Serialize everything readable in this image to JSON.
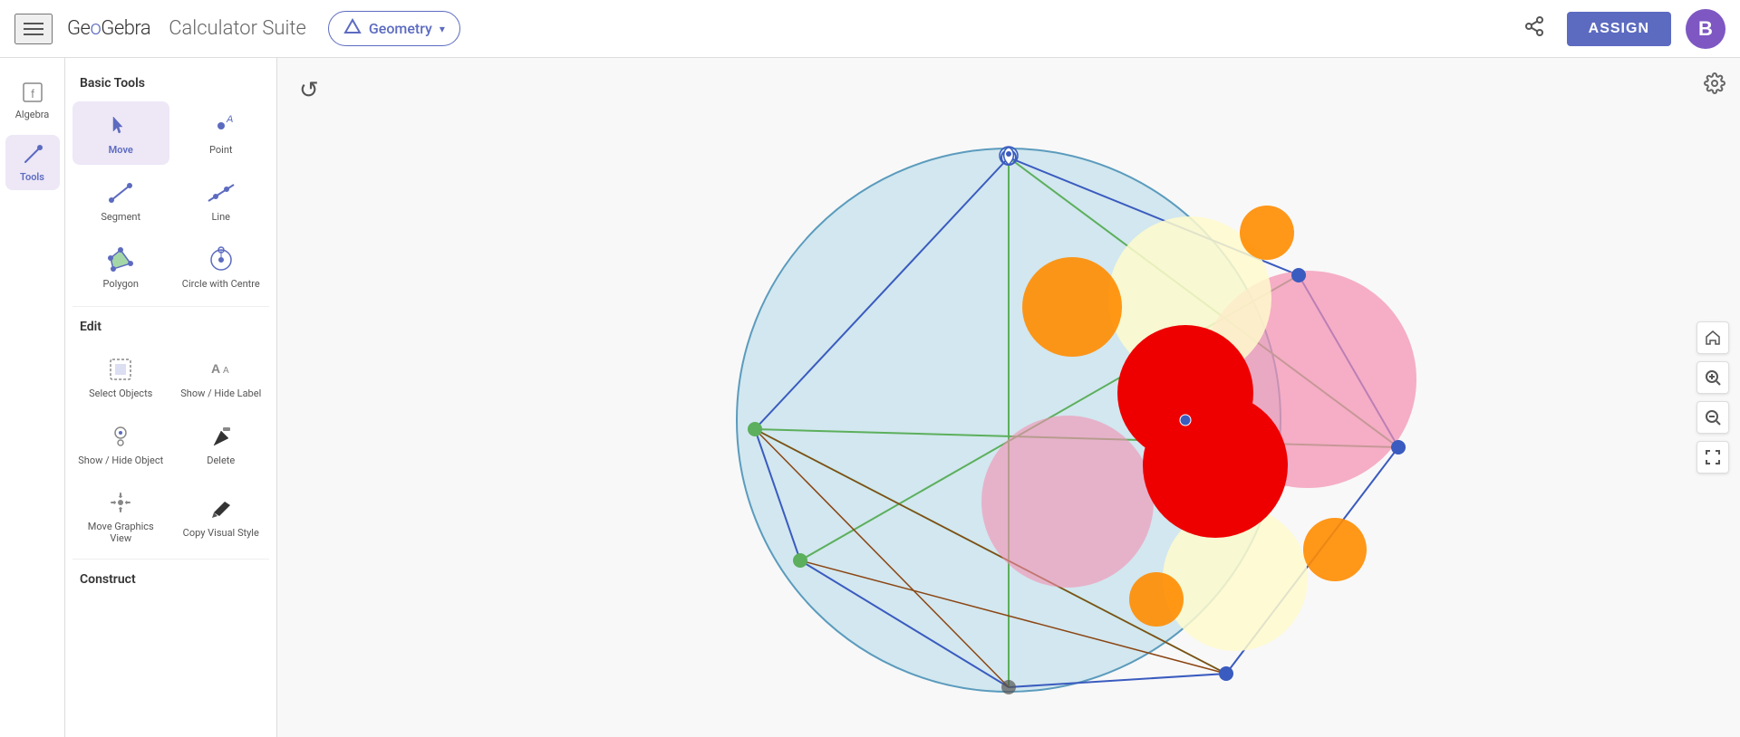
{
  "header": {
    "menu_icon": "☰",
    "logo": "GeoGebra",
    "logo_highlight_letters": "oo",
    "calc_suite": "Calculator Suite",
    "dropdown_label": "Geometry",
    "dropdown_arrow": "▾",
    "share_icon": "⬆",
    "assign_label": "ASSIGN",
    "avatar_label": "B"
  },
  "sidebar": {
    "items": [
      {
        "label": "Algebra",
        "icon": "algebra"
      },
      {
        "label": "Tools",
        "icon": "tools",
        "active": true
      }
    ]
  },
  "tools_panel": {
    "basic_tools_label": "Basic Tools",
    "edit_label": "Edit",
    "construct_label": "Construct",
    "tools": [
      {
        "id": "move",
        "label": "Move",
        "active": true,
        "section": "basic"
      },
      {
        "id": "point",
        "label": "Point",
        "section": "basic"
      },
      {
        "id": "segment",
        "label": "Segment",
        "section": "basic"
      },
      {
        "id": "line",
        "label": "Line",
        "section": "basic"
      },
      {
        "id": "polygon",
        "label": "Polygon",
        "section": "basic"
      },
      {
        "id": "circle-center",
        "label": "Circle with Centre",
        "section": "basic"
      },
      {
        "id": "select-objects",
        "label": "Select Objects",
        "section": "edit"
      },
      {
        "id": "show-hide-label",
        "label": "Show / Hide Label",
        "section": "edit"
      },
      {
        "id": "show-hide-object",
        "label": "Show / Hide Object",
        "section": "edit"
      },
      {
        "id": "delete",
        "label": "Delete",
        "section": "edit"
      },
      {
        "id": "move-graphics",
        "label": "Move Graphics View",
        "section": "edit"
      },
      {
        "id": "copy-visual",
        "label": "Copy Visual Style",
        "section": "edit"
      }
    ]
  },
  "canvas": {
    "undo_label": "↺",
    "settings_icon": "⚙",
    "home_icon": "⌂",
    "zoom_in_icon": "+",
    "zoom_out_icon": "−",
    "fullscreen_icon": "⛶"
  }
}
